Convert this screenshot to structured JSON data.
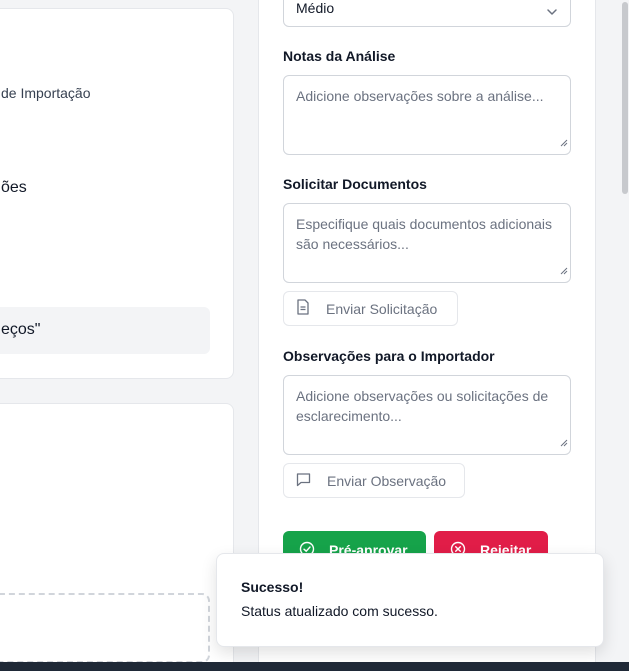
{
  "left_card": {
    "fragment_1": "de Importação",
    "fragment_2": "ões",
    "fragment_3": "eços\""
  },
  "review_panel": {
    "risk_select_value": "Médio",
    "analysis_notes": {
      "label": "Notas da Análise",
      "placeholder": "Adicione observações sobre a análise..."
    },
    "request_documents": {
      "label": "Solicitar Documentos",
      "placeholder": "Especifique quais documentos adicionais são necessários...",
      "button_label": "Enviar Solicitação"
    },
    "importer_observations": {
      "label": "Observações para o Importador",
      "placeholder": "Adicione observações ou solicitações de esclarecimento...",
      "button_label": "Enviar Observação"
    },
    "approve_label": "Pré-aprovar",
    "reject_label": "Rejeitar"
  },
  "toast": {
    "title": "Sucesso!",
    "description": "Status atualizado com sucesso."
  },
  "colors": {
    "approve": "#16a34a",
    "reject": "#e11d48"
  },
  "icons": {
    "select": "chevron-down-icon",
    "request_button": "file-text-icon",
    "observation_button": "message-square-icon",
    "approve_button": "check-circle-icon",
    "reject_button": "x-circle-icon"
  }
}
